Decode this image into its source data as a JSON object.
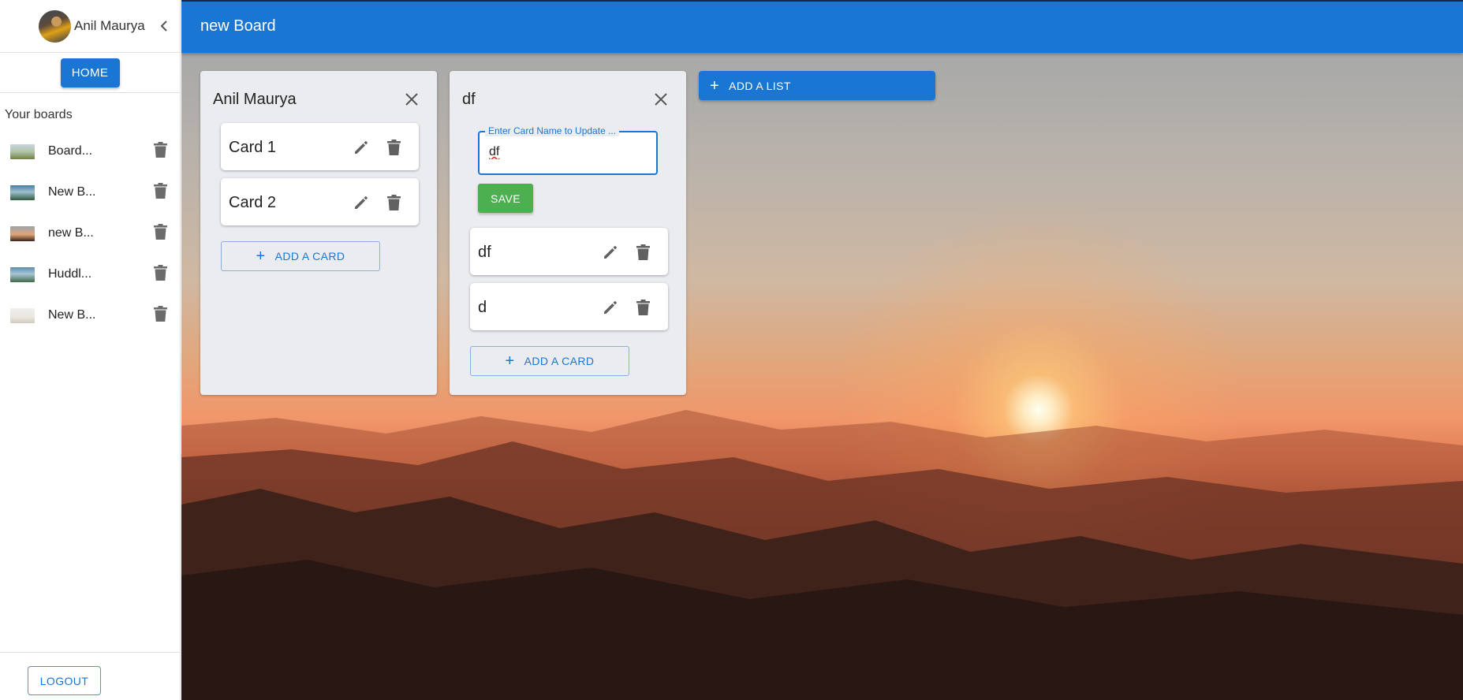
{
  "sidebar": {
    "user_name": "Anil Maurya",
    "home_label": "HOME",
    "section_title": "Your boards",
    "boards": [
      {
        "name": "Board...",
        "thumb": "linear-gradient(180deg,#c6d6e0 0%,#b1c4a4 50%,#6f7f43 100%)"
      },
      {
        "name": "New B...",
        "thumb": "linear-gradient(180deg,#4a7fa3 0%,#9cc0cf 45%,#2e5a3a 100%)"
      },
      {
        "name": "new B...",
        "thumb": "linear-gradient(180deg,#9aa3ab 0%,#e2a67a 55%,#3a2218 100%)"
      },
      {
        "name": "Huddl...",
        "thumb": "linear-gradient(180deg,#5d8db0 0%,#a8c6d4 45%,#3f6a4a 100%)"
      },
      {
        "name": "New B...",
        "thumb": "linear-gradient(180deg,#f0f0ec 0%,#e8e6df 60%,#cfcac0 100%)"
      }
    ],
    "logout_label": "LOGOUT"
  },
  "topbar": {
    "board_title": "new Board"
  },
  "lists": [
    {
      "title": "Anil Maurya",
      "cards": [
        "Card 1",
        "Card 2"
      ],
      "add_card_label": "ADD A CARD"
    },
    {
      "title": "df",
      "edit_field": {
        "label": "Enter Card Name to Update ...",
        "value": "df"
      },
      "save_label": "SAVE",
      "cards": [
        "df",
        "d"
      ],
      "add_card_label": "ADD A CARD"
    }
  ],
  "add_list_label": "ADD A LIST",
  "colors": {
    "primary": "#1976d2",
    "save": "#4caf50",
    "list_bg": "#ebecf0"
  },
  "icons": [
    "chevron-left-icon",
    "trash-icon",
    "close-icon",
    "pencil-icon",
    "plus-icon"
  ]
}
